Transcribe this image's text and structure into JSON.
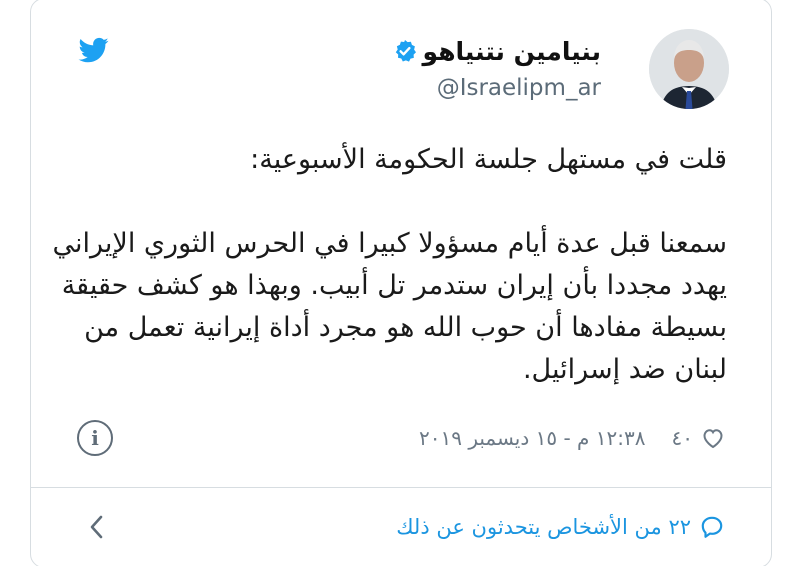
{
  "header": {
    "display_name": "بنيامين نتنياهو",
    "handle": "@Israelipm_ar",
    "verified": true,
    "icons": {
      "logo": "twitter-bird-icon",
      "badge": "verified-badge-icon"
    },
    "colors": {
      "brand": "#1da1f2",
      "verified": "#1da1f2"
    }
  },
  "tweet": {
    "line_1": "قلت في مستهل جلسة الحكومة الأسبوعية:",
    "line_2": "سمعنا قبل عدة أيام مسؤولا كبيرا في الحرس الثوري الإيراني يهدد مجددا بأن إيران ستدمر تل أبيب. وبهذا هو كشف حقيقة بسيطة مفادها أن حوب الله هو مجرد أداة إيرانية تعمل من لبنان ضد إسرائيل."
  },
  "meta": {
    "likes_count": "٤٠",
    "timestamp": "١٢:٣٨ م - ١٥ ديسمبر ٢٠١٩",
    "icons": {
      "like": "heart-icon",
      "info": "info-icon"
    }
  },
  "footer": {
    "conversation_text": "٢٢ من الأشخاص يتحدثون عن ذلك",
    "icons": {
      "conversation": "speech-bubble-icon",
      "chevron": "chevron-left-icon"
    },
    "colors": {
      "link": "#1b95e0"
    }
  }
}
